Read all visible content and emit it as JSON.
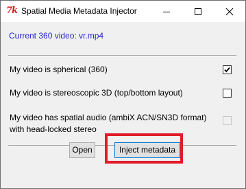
{
  "window": {
    "title": "Spatial Media Metadata Injector",
    "app_icon_glyph": "7k",
    "app_icon_name": "tk-feather-icon",
    "controls": [
      "minimize-icon",
      "maximize-icon",
      "close-icon"
    ]
  },
  "main": {
    "current_video": "Current 360 video: vr.mp4",
    "options": [
      {
        "label": "My video is spherical (360)",
        "checked": true,
        "enabled": true
      },
      {
        "label": "My video is stereoscopic 3D (top/bottom layout)",
        "checked": false,
        "enabled": true
      },
      {
        "label_line1": "My video has spatial audio (ambiX ACN/SN3D format)",
        "label_line2": "with head-locked stereo",
        "checked": false,
        "enabled": false
      }
    ]
  },
  "buttons": {
    "open": "Open",
    "inject": "Inject metadata"
  },
  "colors": {
    "link_text": "#1f1fd0",
    "highlight": "#e01c2a",
    "focus_border": "#0078d7"
  }
}
